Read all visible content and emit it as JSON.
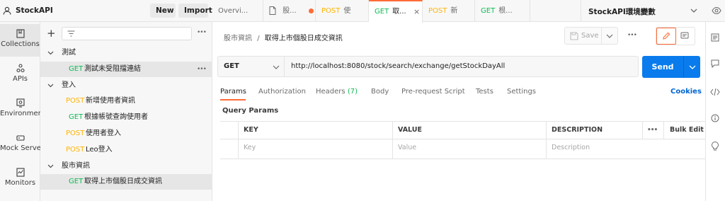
{
  "header": {
    "workspace_name": "StockAPI",
    "new_label": "New",
    "import_label": "Import",
    "environment": "StockAPI環境變數"
  },
  "tabs": [
    {
      "label": "Overvi...",
      "method": ""
    },
    {
      "label": "股...",
      "method": ""
    },
    {
      "label": "使",
      "method": "POST"
    },
    {
      "label": "取...",
      "method": "GET"
    },
    {
      "label": "新",
      "method": "POST"
    },
    {
      "label": "根...",
      "method": "GET"
    }
  ],
  "rail": [
    {
      "label": "Collections"
    },
    {
      "label": "APIs"
    },
    {
      "label": "Environments"
    },
    {
      "label": "Mock Servers"
    },
    {
      "label": "Monitors"
    }
  ],
  "collections": {
    "items": [
      {
        "type": "folder",
        "label": "測試"
      },
      {
        "type": "request",
        "method": "GET",
        "label": "測試未受阻擋連結"
      },
      {
        "type": "folder",
        "label": "登入"
      },
      {
        "type": "request",
        "method": "POST",
        "label": "新增使用者資訊"
      },
      {
        "type": "request",
        "method": "GET",
        "label": "根據帳號查詢使用者"
      },
      {
        "type": "request",
        "method": "POST",
        "label": "使用者登入"
      },
      {
        "type": "request",
        "method": "POST",
        "label": "Leo登入"
      },
      {
        "type": "folder",
        "label": "股市資訊"
      },
      {
        "type": "request",
        "method": "GET",
        "label": "取得上市個股日成交資訊"
      }
    ]
  },
  "request": {
    "breadcrumb_parent": "股市資訊",
    "breadcrumb_sep": "/",
    "breadcrumb_current": "取得上市個股日成交資訊",
    "save_label": "Save",
    "method": "GET",
    "url": "http://localhost:8080/stock/search/exchange/getStockDayAll",
    "send_label": "Send"
  },
  "request_tabs": [
    {
      "label": "Params"
    },
    {
      "label": "Authorization"
    },
    {
      "label": "Headers",
      "count": "(7)"
    },
    {
      "label": "Body"
    },
    {
      "label": "Pre-request Script"
    },
    {
      "label": "Tests"
    },
    {
      "label": "Settings"
    }
  ],
  "cookies_label": "Cookies",
  "query_params": {
    "title": "Query Params",
    "headers": [
      "KEY",
      "VALUE",
      "DESCRIPTION"
    ],
    "more": "•••",
    "bulk_edit": "Bulk Edit",
    "placeholders": [
      "Key",
      "Value",
      "Description"
    ]
  },
  "colors": {
    "accent": "#ff6c37",
    "send_button": "#097bed",
    "get": "#0cbb52",
    "post": "#ffb400",
    "link": "#0265d2"
  }
}
